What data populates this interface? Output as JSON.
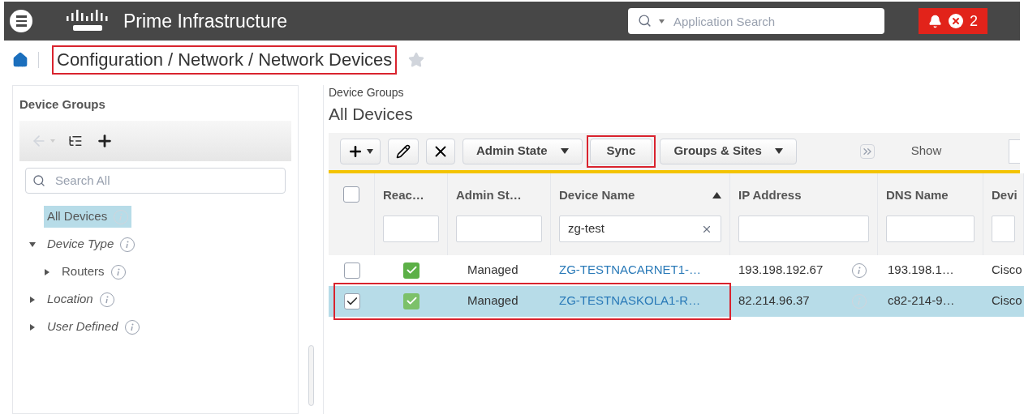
{
  "header": {
    "brand": "Prime Infrastructure",
    "search": {
      "placeholder": "Application Search"
    },
    "alarm_count": "2"
  },
  "breadcrumb": {
    "text": "Configuration / Network / Network Devices",
    "highlighted": true,
    "favorite": false
  },
  "sidebar": {
    "title": "Device Groups",
    "search": {
      "placeholder": "Search All"
    },
    "items": [
      {
        "label": "All Devices",
        "kind": "group",
        "selected": true
      },
      {
        "label": "Device Type",
        "kind": "category",
        "selected": false,
        "expanded": true,
        "children": [
          {
            "label": "Routers",
            "kind": "group",
            "selected": false,
            "expanded": false
          }
        ]
      },
      {
        "label": "Location",
        "kind": "category",
        "selected": false,
        "expanded": false
      },
      {
        "label": "User Defined",
        "kind": "category",
        "selected": false,
        "expanded": false
      }
    ]
  },
  "content": {
    "subtitle": "Device Groups",
    "title": "All Devices",
    "toolbar": [
      {
        "kind": "add"
      },
      {
        "kind": "edit"
      },
      {
        "kind": "delete"
      },
      {
        "kind": "dropdown",
        "label": "Admin State",
        "highlighted": false
      },
      {
        "kind": "button",
        "label": "Sync",
        "highlighted": true
      },
      {
        "kind": "dropdown",
        "label": "Groups & Sites",
        "highlighted": false
      }
    ],
    "show_label": "Show",
    "table": {
      "select_all_checked": false,
      "columns": [
        {
          "label": "Reac…",
          "sorted": false
        },
        {
          "label": "Admin St…",
          "sorted": false
        },
        {
          "label": "Device Name",
          "sorted": true,
          "filter": "zg-test"
        },
        {
          "label": "IP Address",
          "sorted": false
        },
        {
          "label": "DNS Name",
          "sorted": false
        },
        {
          "label": "Devi"
        }
      ],
      "rows": [
        {
          "checked": false,
          "selected": false,
          "highlighted": false,
          "reachable": true,
          "admin_state": "Managed",
          "device_name": "ZG-TESTNACARNET1-…",
          "ip_address": "193.198.192.67",
          "dns_name": "193.198.1…",
          "column_6": "Cisco"
        },
        {
          "checked": true,
          "selected": true,
          "highlighted": true,
          "reachable": true,
          "admin_state": "Managed",
          "device_name": "ZG-TESTNASKOLA1-R…",
          "ip_address": "82.214.96.37",
          "dns_name": "c82-214-9…",
          "column_6": "Cisco"
        }
      ]
    }
  }
}
